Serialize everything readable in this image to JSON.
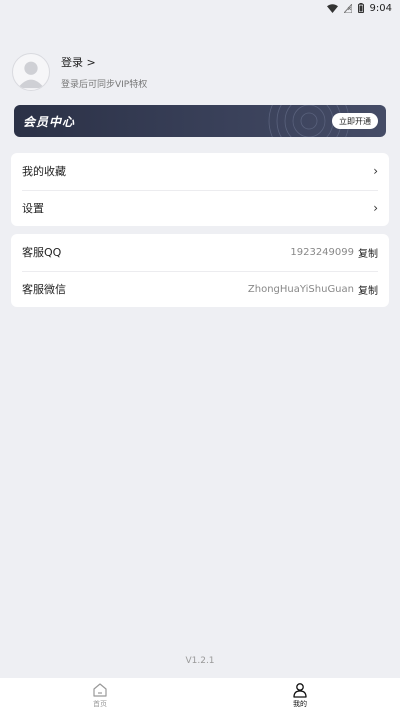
{
  "status_bar": {
    "time": "9:04",
    "icons": [
      "wifi-icon",
      "no-signal-icon",
      "battery-icon"
    ]
  },
  "profile": {
    "login_label": "登录 >",
    "subtitle": "登录后可同步VIP特权"
  },
  "vip": {
    "title": "会员中心",
    "button_label": "立即开通"
  },
  "menu": {
    "favorites_label": "我的收藏",
    "settings_label": "设置"
  },
  "contact": {
    "qq_label": "客服QQ",
    "qq_value": "1923249099",
    "qq_copy": "复制",
    "wechat_label": "客服微信",
    "wechat_value": "ZhongHuaYiShuGuan",
    "wechat_copy": "复制"
  },
  "version": "V1.2.1",
  "nav": {
    "home_label": "首页",
    "mine_label": "我的"
  },
  "colors": {
    "background": "#eeeff3",
    "banner": "#394059",
    "card": "#ffffff"
  }
}
